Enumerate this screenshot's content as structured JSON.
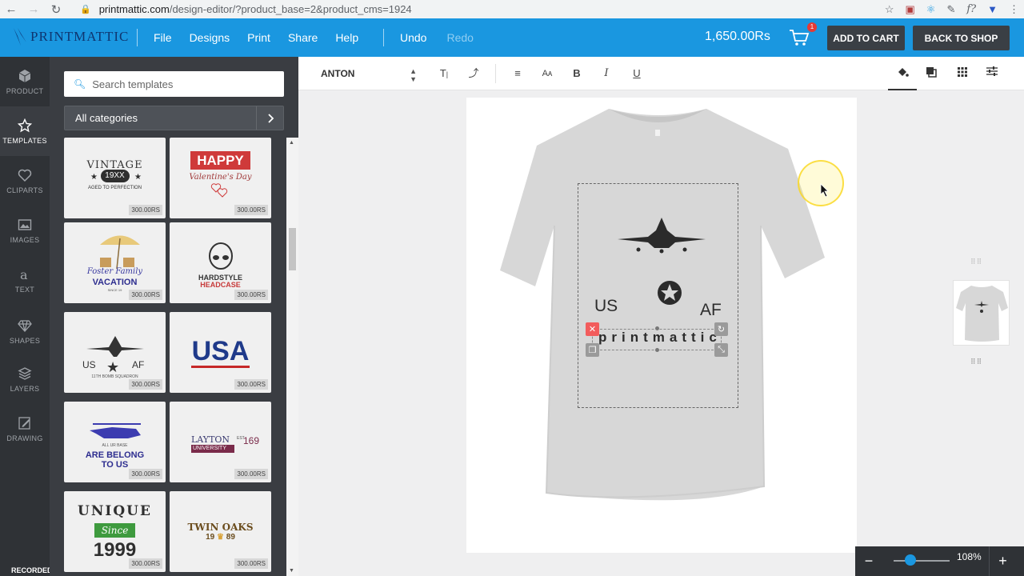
{
  "browser": {
    "url_domain": "printmattic.com",
    "url_path": "/design-editor/?product_base=2&product_cms=1924"
  },
  "header": {
    "logo_text": "PRINTMATTIC",
    "menu": [
      "File",
      "Designs",
      "Print",
      "Share",
      "Help"
    ],
    "undo": "Undo",
    "redo": "Redo",
    "price": "1,650.00Rs",
    "cart_count": "1",
    "add_to_cart": "ADD TO CART",
    "back_to_shop": "BACK TO SHOP",
    "brand_color": "#1a97e0"
  },
  "rail": [
    {
      "label": "PRODUCT",
      "icon": "cube-icon"
    },
    {
      "label": "TEMPLATES",
      "icon": "star-icon"
    },
    {
      "label": "CLIPARTS",
      "icon": "heart-icon"
    },
    {
      "label": "IMAGES",
      "icon": "image-icon"
    },
    {
      "label": "TEXT",
      "icon": "text-icon"
    },
    {
      "label": "SHAPES",
      "icon": "diamond-icon"
    },
    {
      "label": "LAYERS",
      "icon": "layers-icon"
    },
    {
      "label": "DRAWING",
      "icon": "pencil-icon"
    }
  ],
  "recorded_label": "RECORDED WITH",
  "panel": {
    "search_placeholder": "Search templates",
    "category": "All categories",
    "templates": [
      {
        "lines": [
          "VINTAGE",
          "19XX",
          "AGED TO PERFECTION"
        ],
        "price": "300.00RS"
      },
      {
        "lines": [
          "HAPPY",
          "Valentine's Day"
        ],
        "price": "300.00RS"
      },
      {
        "lines": [
          "Foster Family",
          "VACATION",
          "SINCE 19"
        ],
        "price": "300.00RS"
      },
      {
        "lines": [
          "HARDSTYLE",
          "HEADCASE"
        ],
        "price": "300.00RS"
      },
      {
        "lines": [
          "US",
          "AF",
          "11TH BOMB SQUADRON"
        ],
        "price": "300.00RS"
      },
      {
        "lines": [
          "USA"
        ],
        "price": "300.00RS"
      },
      {
        "lines": [
          "ALL UR BASE",
          "ARE BELONG",
          "TO US"
        ],
        "price": "300.00RS"
      },
      {
        "lines": [
          "LAYTON",
          "UNIVERSITY",
          "EST",
          "169"
        ],
        "price": "300.00RS"
      },
      {
        "lines": [
          "UNIQUE",
          "Since",
          "1999"
        ],
        "price": "300.00RS"
      },
      {
        "lines": [
          "TWIN OAKS",
          "19",
          "89"
        ],
        "price": "300.00RS"
      }
    ]
  },
  "toolbar": {
    "font": "ANTON"
  },
  "design": {
    "us": "US",
    "af": "AF",
    "text": "printmattic"
  },
  "zoom": {
    "value": "108%",
    "level": 0.3
  }
}
